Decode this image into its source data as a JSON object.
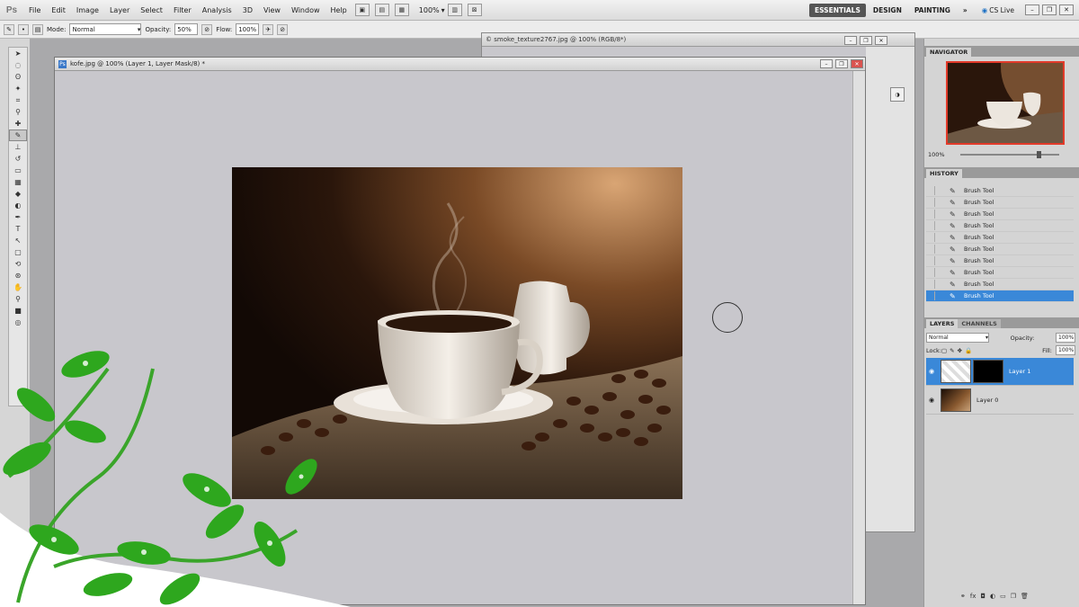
{
  "app": {
    "logo": "Ps"
  },
  "menu": [
    "File",
    "Edit",
    "Image",
    "Layer",
    "Select",
    "Filter",
    "Analysis",
    "3D",
    "View",
    "Window",
    "Help"
  ],
  "zoom_select": "100%",
  "workspaces": [
    "ESSENTIALS",
    "DESIGN",
    "PAINTING"
  ],
  "workspace_more": "»",
  "cs_live": "CS Live",
  "options_bar": {
    "mode_label": "Mode:",
    "mode_value": "Normal",
    "opacity_label": "Opacity:",
    "opacity_value": "50%",
    "flow_label": "Flow:",
    "flow_value": "100%"
  },
  "background_doc": {
    "title": "© smoke_texture2767.jpg @ 100% (RGB/8*)"
  },
  "main_doc": {
    "title": "kofe.jpg @ 100% (Layer 1, Layer Mask/8) *"
  },
  "navigator": {
    "tab": "NAVIGATOR",
    "zoom": "100%"
  },
  "history": {
    "tab": "HISTORY",
    "items": [
      {
        "label": "Brush Tool"
      },
      {
        "label": "Brush Tool"
      },
      {
        "label": "Brush Tool"
      },
      {
        "label": "Brush Tool"
      },
      {
        "label": "Brush Tool"
      },
      {
        "label": "Brush Tool"
      },
      {
        "label": "Brush Tool"
      },
      {
        "label": "Brush Tool"
      },
      {
        "label": "Brush Tool"
      },
      {
        "label": "Brush Tool"
      }
    ]
  },
  "layers": {
    "tab": "LAYERS",
    "tab2": "CHANNELS",
    "blend": "Normal",
    "opacity_label": "Opacity:",
    "opacity_value": "100%",
    "lock_label": "Lock:",
    "fill_label": "Fill:",
    "fill_value": "100%",
    "items": [
      {
        "name": "Layer 1",
        "selected": true
      },
      {
        "name": "Layer 0",
        "selected": false
      }
    ]
  },
  "colors": {
    "selection": "#3a88d8",
    "workspace_bg": "#a9a9ab",
    "canvas_bg": "#c8c7cc"
  }
}
